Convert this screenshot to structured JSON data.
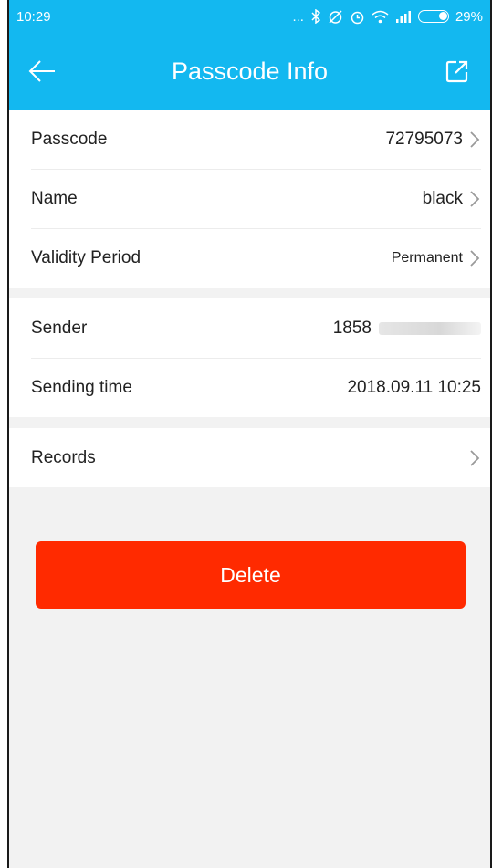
{
  "status_bar": {
    "time": "10:29",
    "dots": "...",
    "battery": "29%",
    "icons": [
      "bluetooth-icon",
      "alarm-off-icon",
      "alarm-icon",
      "wifi-icon",
      "signal-icon",
      "battery-icon"
    ]
  },
  "header": {
    "title": "Passcode Info",
    "back_icon": "arrow-left-icon",
    "action_icon": "share-icon"
  },
  "info": {
    "passcode_label": "Passcode",
    "passcode_value": "72795073",
    "name_label": "Name",
    "name_value": "black",
    "validity_label": "Validity Period",
    "validity_value": "Permanent"
  },
  "sender_info": {
    "sender_label": "Sender",
    "sender_value": "1858",
    "sending_time_label": "Sending time",
    "sending_time_value": "2018.09.11 10:25"
  },
  "records": {
    "label": "Records"
  },
  "actions": {
    "delete_label": "Delete"
  },
  "colors": {
    "header": "#13b8f0",
    "delete": "#ff2a00",
    "background": "#f2f2f2"
  }
}
